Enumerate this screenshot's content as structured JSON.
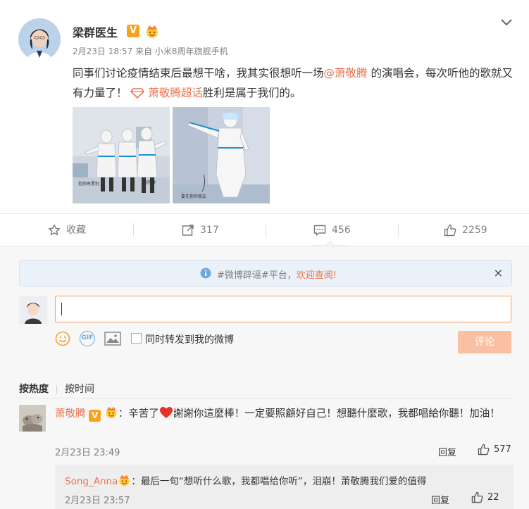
{
  "post": {
    "author": "梁群医生",
    "verified_badge": "V",
    "meta": "2月23日 18:57 来自 小米8周年旗舰手机",
    "text_part1": "同事们讨论疫情结束后最想干啥，我其实很想听一场",
    "mention": "@萧敬腾",
    "text_part2": " 的演唱会，每次听他的歌就又有力量了！ ",
    "topic": "萧敬腾超话",
    "text_part3": "胜利是属于我们的。",
    "image1_caption_left": "抱怨再累别",
    "image1_caption_right": "抱怨再",
    "image2_caption": "要先抱你朋友"
  },
  "actions": {
    "favorite": "收藏",
    "repost": "317",
    "comment": "456",
    "like": "2259"
  },
  "notice": {
    "prefix": "#微博辟谣#平台，",
    "highlight": "欢迎查阅!",
    "close": "×"
  },
  "composer": {
    "placeholder": "",
    "also_repost": "同时转发到我的微博",
    "submit": "评论",
    "gif": "GIF"
  },
  "sort": {
    "hot": "按热度",
    "time": "按时间"
  },
  "comment": {
    "name": "萧敬腾",
    "badge": "V",
    "text_a": "：辛苦了",
    "text_b": "謝謝你這麼棒！一定要照顧好自己！想聽什麼歌，我都唱給你聽！加油！",
    "time": "2月23日 23:49",
    "reply": "回复",
    "likes": "577"
  },
  "subcomment": {
    "name": "Song_Anna",
    "text": "：最后一句“想听什么歌，我都唱给你听”，泪崩！萧敬腾我们爱的值得",
    "time": "2月23日 23:57",
    "reply": "回复",
    "likes": "22"
  },
  "colors": {
    "accent": "#eb7350",
    "badge": "#f7a21a",
    "submit_disabled": "#f9c0a4"
  }
}
